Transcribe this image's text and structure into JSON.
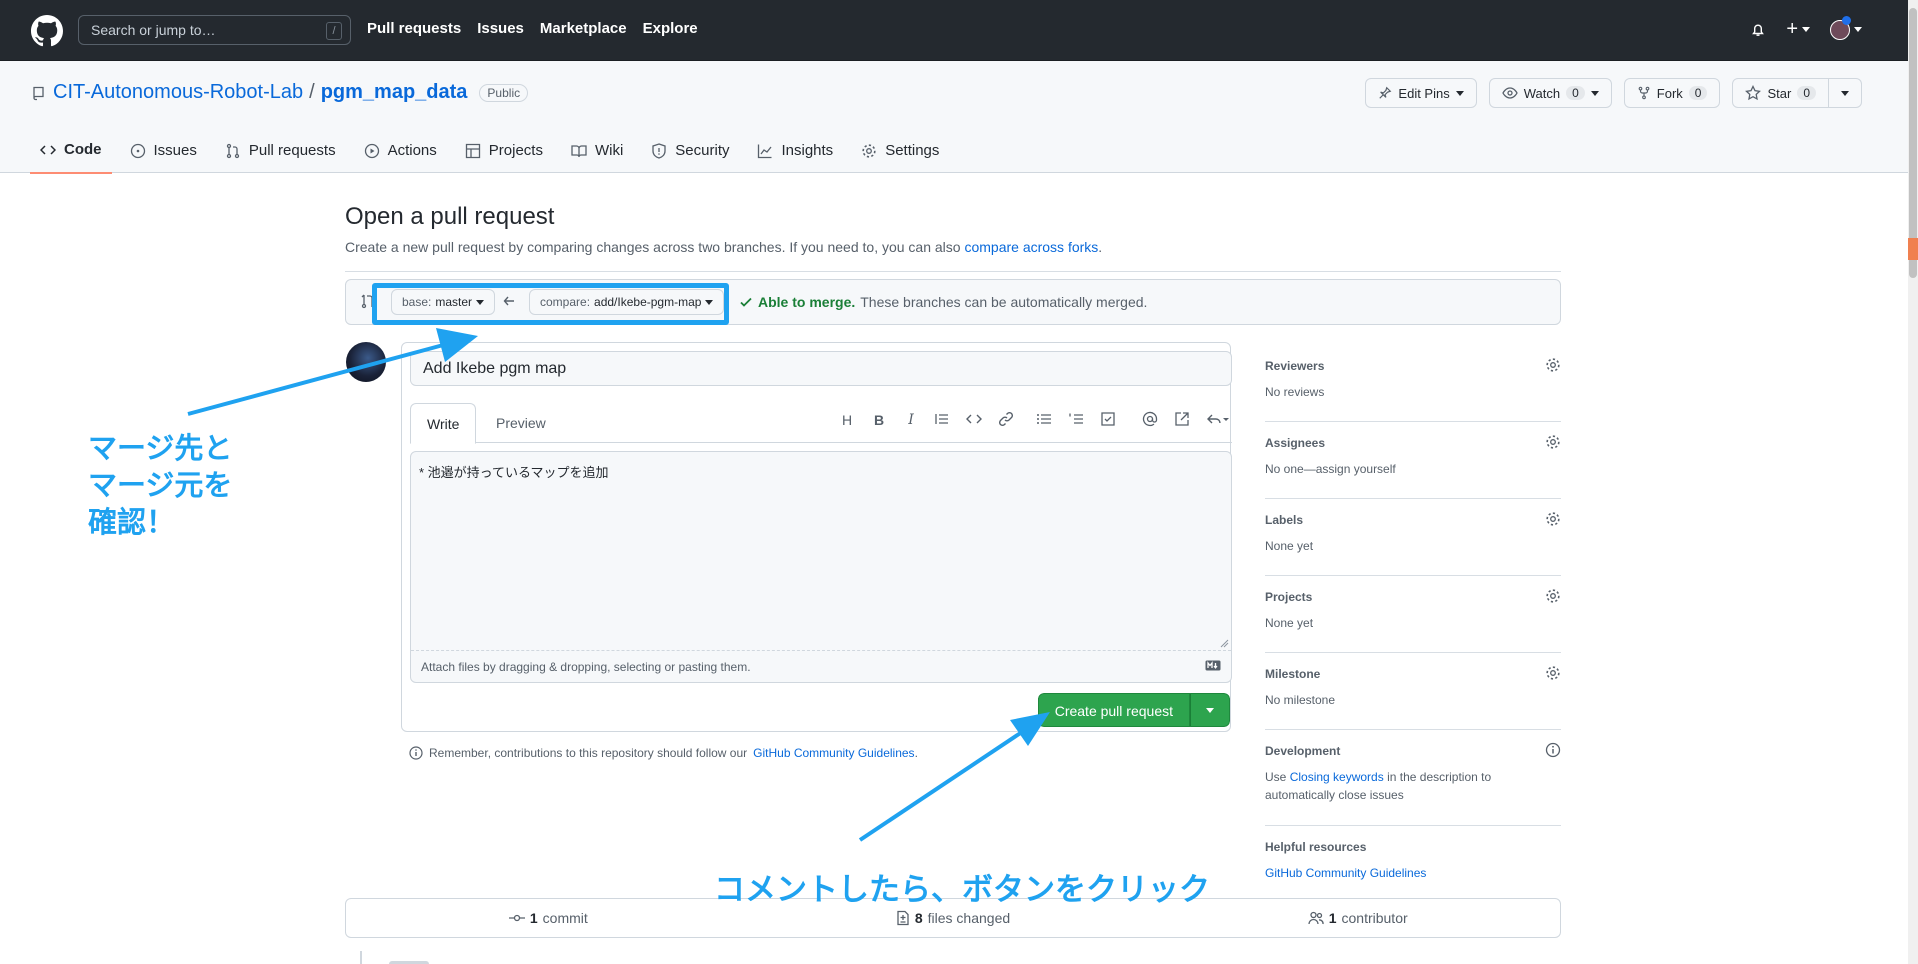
{
  "header": {
    "search_placeholder": "Search or jump to…",
    "search_key": "/",
    "nav": [
      "Pull requests",
      "Issues",
      "Marketplace",
      "Explore"
    ],
    "plus": "+"
  },
  "repo": {
    "owner": "CIT-Autonomous-Robot-Lab",
    "sep": "/",
    "name": "pgm_map_data",
    "visibility": "Public",
    "edit_pins": "Edit Pins",
    "watch": "Watch",
    "watch_count": "0",
    "fork": "Fork",
    "fork_count": "0",
    "star": "Star",
    "star_count": "0"
  },
  "tabs": [
    "Code",
    "Issues",
    "Pull requests",
    "Actions",
    "Projects",
    "Wiki",
    "Security",
    "Insights",
    "Settings"
  ],
  "page": {
    "title": "Open a pull request",
    "subtitle": "Create a new pull request by comparing changes across two branches. If you need to, you can also",
    "subtitle_link": "compare across forks",
    "subtitle_end": "."
  },
  "range": {
    "base_label": "base:",
    "base_value": "master",
    "compare_label": "compare:",
    "compare_value": "add/Ikebe-pgm-map",
    "merge_status": "Able to merge.",
    "merge_text": "These branches can be automatically merged."
  },
  "form": {
    "title_value": "Add Ikebe pgm map",
    "tab_write": "Write",
    "tab_preview": "Preview",
    "toolbar": [
      "H",
      "B",
      "I"
    ],
    "body": "* 池邉が持っているマップを追加",
    "attach": "Attach files by dragging & dropping, selecting or pasting them.",
    "create": "Create pull request",
    "remember": "Remember, contributions to this repository should follow our",
    "remember_link": "GitHub Community Guidelines",
    "remember_end": "."
  },
  "sidebar": {
    "reviewers": "Reviewers",
    "reviewers_value": "No reviews",
    "assignees": "Assignees",
    "assignees_value": "No one—assign yourself",
    "labels": "Labels",
    "labels_value": "None yet",
    "projects": "Projects",
    "projects_value": "None yet",
    "milestone": "Milestone",
    "milestone_value": "No milestone",
    "development": "Development",
    "development_pre": "Use",
    "development_link": "Closing keywords",
    "development_post": "in the description to automatically close issues",
    "helpful": "Helpful resources",
    "helpful_link": "GitHub Community Guidelines"
  },
  "summary": {
    "commits": "1",
    "commits_label": "commit",
    "files": "8",
    "files_label": "files changed",
    "contributors": "1",
    "contributors_label": "contributor"
  },
  "annotations": {
    "left": "マージ先と\nマージ元を\n確認！",
    "bottom": "コメントしたら、ボタンをクリック",
    "color": "#1fa2f0"
  }
}
